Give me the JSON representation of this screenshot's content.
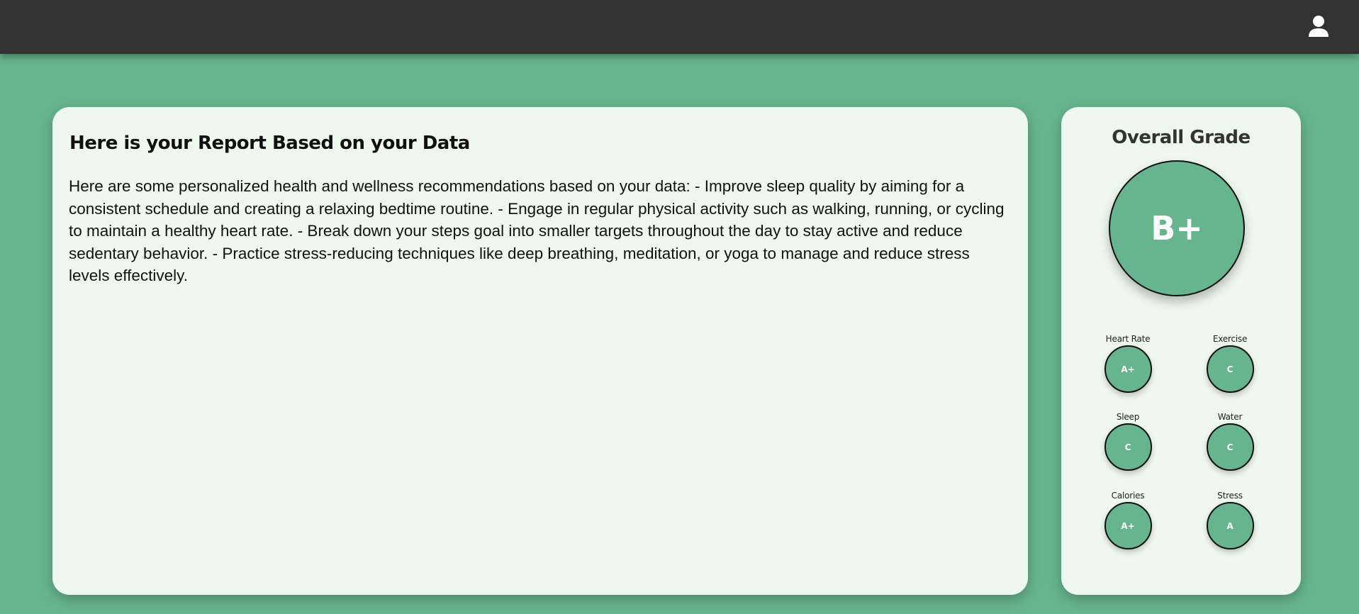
{
  "header": {
    "profile_icon": "user-icon"
  },
  "report": {
    "title": "Here is your Report Based on your Data",
    "body": "Here are some personalized health and wellness recommendations based on your data: - Improve sleep quality by aiming for a consistent schedule and creating a relaxing bedtime routine. - Engage in regular physical activity such as walking, running, or cycling to maintain a healthy heart rate. - Break down your steps goal into smaller targets throughout the day to stay active and reduce sedentary behavior. - Practice stress-reducing techniques like deep breathing, meditation, or yoga to manage and reduce stress levels effectively."
  },
  "grades": {
    "title": "Overall Grade",
    "overall": "B+",
    "metrics": [
      {
        "label": "Heart Rate",
        "grade": "A+"
      },
      {
        "label": "Exercise",
        "grade": "C"
      },
      {
        "label": "Sleep",
        "grade": "C"
      },
      {
        "label": "Water",
        "grade": "C"
      },
      {
        "label": "Calories",
        "grade": "A+"
      },
      {
        "label": "Stress",
        "grade": "A"
      }
    ]
  },
  "colors": {
    "background": "#67b58e",
    "header": "#333333",
    "card": "#eff8ee",
    "grade_fill": "#67b58e"
  }
}
